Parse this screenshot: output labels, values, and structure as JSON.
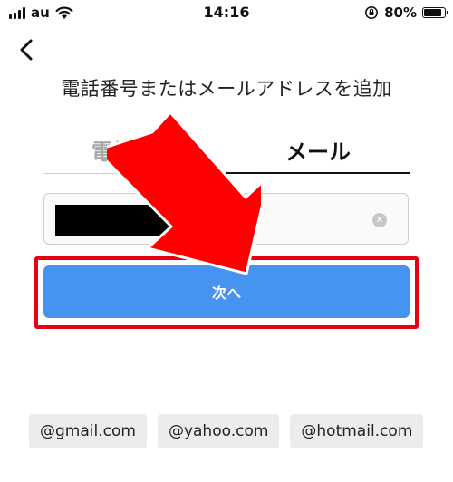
{
  "status_bar": {
    "carrier": "au",
    "time": "14:16",
    "battery": "80%",
    "battery_level": 0.8
  },
  "header": {
    "back_icon": "chevron-left-icon",
    "title": "電話番号またはメールアドレスを追加"
  },
  "tabs": [
    {
      "label": "電話番号",
      "active": false
    },
    {
      "label": "メール",
      "active": true
    }
  ],
  "email_input": {
    "value": "",
    "redacted": true,
    "clear_icon": "clear-icon"
  },
  "next_button": {
    "label": "次へ"
  },
  "annotations": {
    "highlight_color": "#e60012",
    "arrow_color": "#ff0000"
  },
  "suggestions": [
    "@gmail.com",
    "@yahoo.com",
    "@hotmail.com"
  ],
  "colors": {
    "primary_button": "#4793f2",
    "inactive_tab": "#a8a8a8"
  }
}
